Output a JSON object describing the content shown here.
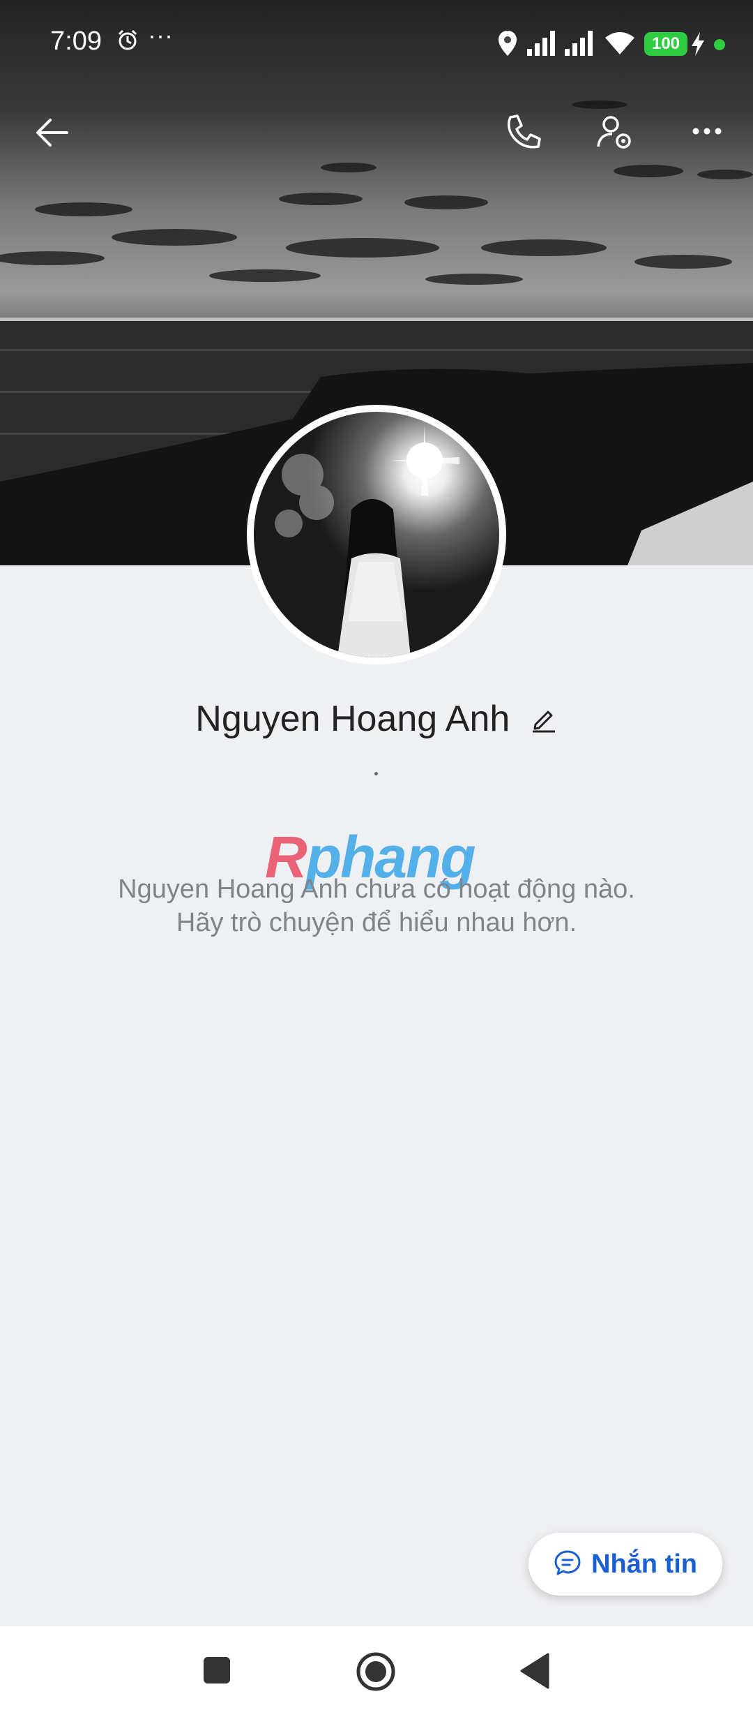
{
  "status_bar": {
    "time": "7:09",
    "more_indicator": "···",
    "battery": "100",
    "icons": [
      "alarm-icon",
      "location-icon",
      "signal-icon",
      "signal-icon",
      "wifi-icon",
      "charging-icon"
    ]
  },
  "top_bar": {
    "icons": [
      "back-arrow-icon",
      "phone-icon",
      "user-settings-icon",
      "more-icon"
    ]
  },
  "profile": {
    "name": "Nguyen Hoang Anh",
    "status_dot": "."
  },
  "watermark": {
    "letter": "R",
    "text": "phang"
  },
  "empty_state": {
    "line1": "Nguyen Hoang Anh chưa có hoạt động nào.",
    "line2": "Hãy trò chuyện để hiểu nhau hơn."
  },
  "message_button": {
    "label": "Nhắn tin",
    "icon": "chat-bubble-icon"
  },
  "nav_bar": {
    "icons": [
      "recents-square-icon",
      "home-circle-icon",
      "back-triangle-icon"
    ]
  },
  "colors": {
    "background": "#eff0f4",
    "accent": "#1a5fd1",
    "battery": "#2ecc40"
  }
}
